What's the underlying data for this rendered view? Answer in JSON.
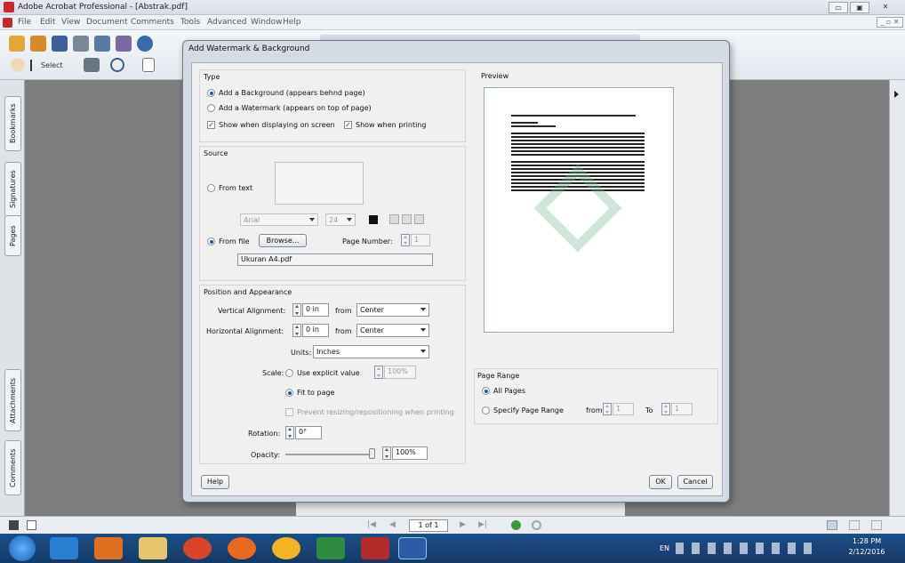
{
  "window": {
    "title": "Adobe Acrobat Professional - [Abstrak.pdf]"
  },
  "menu": [
    "File",
    "Edit",
    "View",
    "Document",
    "Comments",
    "Tools",
    "Advanced",
    "Window",
    "Help"
  ],
  "toolbar": {
    "select_label": "Select"
  },
  "nav_tabs": [
    "Bookmarks",
    "Signatures",
    "Pages",
    "Attachments",
    "Comments"
  ],
  "dialog": {
    "title": "Add Watermark & Background",
    "type": {
      "label": "Type",
      "opt_background": "Add a Background (appears behnd page)",
      "opt_watermark": "Add a Watermark (appears on top of page)",
      "show_screen": "Show when displaying on screen",
      "show_print": "Show when printing"
    },
    "source": {
      "label": "Source",
      "from_text": "From text",
      "font": "Arial",
      "size": "24",
      "from_file": "From file",
      "browse": "Browse...",
      "page_number_label": "Page Number:",
      "page_number": "1",
      "file_name": "Ukuran A4.pdf"
    },
    "position": {
      "label": "Position and Appearance",
      "vertical_label": "Vertical Alignment:",
      "vertical_value": "0 in",
      "from": "from",
      "vertical_from": "Center",
      "horizontal_label": "Horizontal Alignment:",
      "horizontal_value": "0 in",
      "horizontal_from": "Center",
      "units_label": "Units:",
      "units": "Inches",
      "scale_label": "Scale:",
      "explicit": "Use explicit value",
      "explicit_value": "100%",
      "fit": "Fit to page",
      "prevent": "Prevent resizing/repositioning when printing",
      "rotation_label": "Rotation:",
      "rotation": "0°",
      "opacity_label": "Opacity:",
      "opacity": "100%"
    },
    "preview": {
      "label": "Preview"
    },
    "page_range": {
      "label": "Page Range",
      "all": "All Pages",
      "specify": "Specify Page Range",
      "from": "from",
      "from_value": "1",
      "to": "To",
      "to_value": "1"
    },
    "help": "Help",
    "ok": "OK",
    "cancel": "Cancel"
  },
  "status": {
    "page": "1 of 1"
  },
  "tray": {
    "lang": "EN",
    "time": "1:28 PM",
    "date": "2/12/2016"
  }
}
